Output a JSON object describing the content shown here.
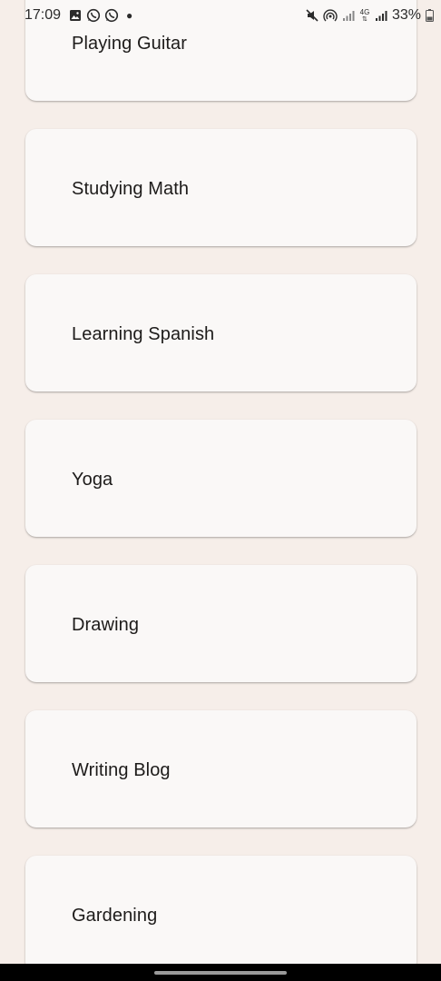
{
  "status_bar": {
    "time": "17:09",
    "battery": "33%",
    "network": "4G",
    "icons_left": [
      "gallery-icon",
      "whatsapp-icon",
      "whatsapp-icon",
      "dot-icon"
    ],
    "icons_right": [
      "mute-icon",
      "hotspot-icon",
      "signal-icon",
      "network-4g-icon",
      "signal-icon",
      "battery-icon"
    ]
  },
  "list": {
    "items": [
      {
        "label": "Playing Guitar"
      },
      {
        "label": "Studying Math"
      },
      {
        "label": "Learning Spanish"
      },
      {
        "label": "Yoga"
      },
      {
        "label": "Drawing"
      },
      {
        "label": "Writing Blog"
      },
      {
        "label": "Gardening"
      }
    ]
  },
  "colors": {
    "background": "#f6eee9",
    "card": "#faf8f7",
    "text": "#1d1b1a"
  }
}
